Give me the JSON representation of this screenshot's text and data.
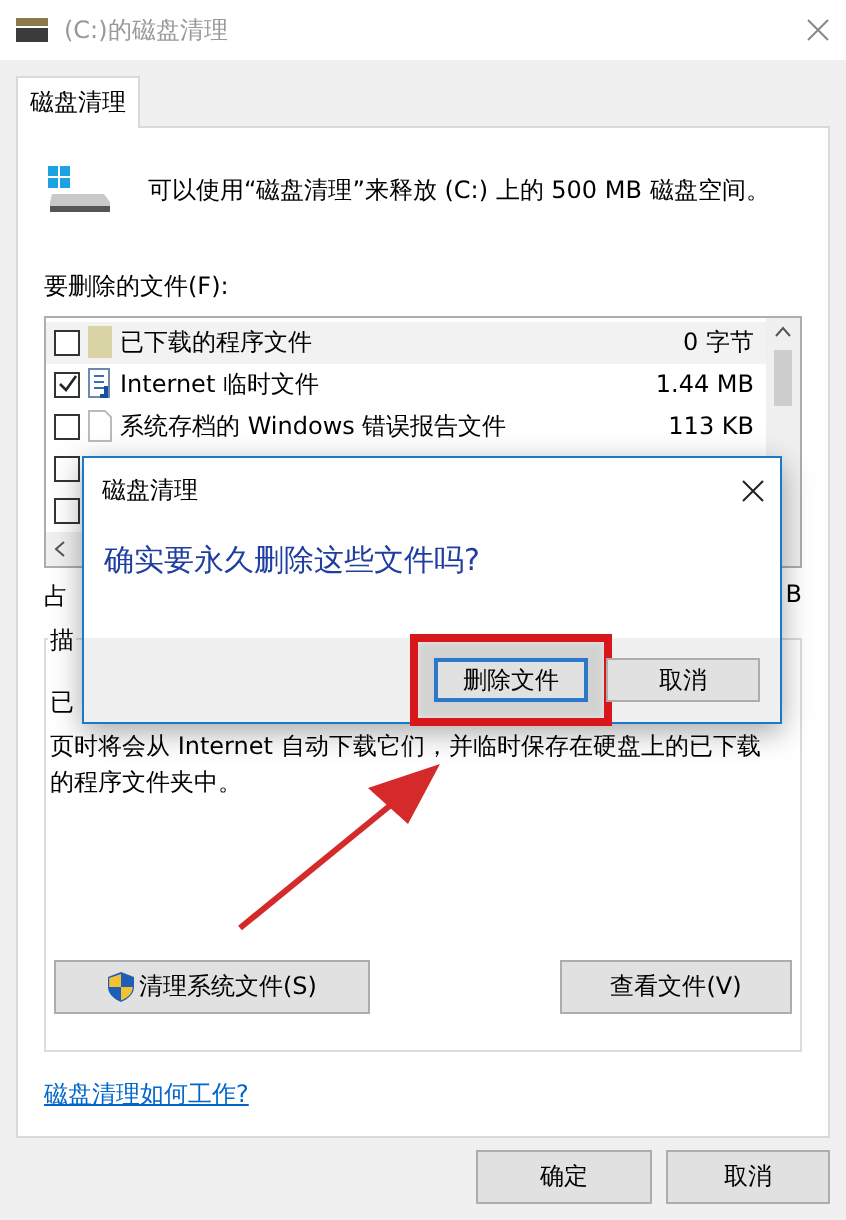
{
  "window": {
    "title": "(C:)的磁盘清理"
  },
  "tabs": [
    {
      "label": "磁盘清理",
      "selected": true
    }
  ],
  "header": {
    "message": "可以使用“磁盘清理”来释放  (C:) 上的 500 MB 磁盘空间。"
  },
  "files": {
    "label": "要删除的文件(F):",
    "rows": [
      {
        "kind": "folder",
        "name": "已下载的程序文件",
        "size": "0 字节",
        "checked": false,
        "selected": true
      },
      {
        "kind": "web",
        "name": "Internet 临时文件",
        "size": "1.44 MB",
        "checked": true,
        "selected": false
      },
      {
        "kind": "doc",
        "name": "系统存档的 Windows 错误报告文件",
        "size": "113 KB",
        "checked": false,
        "selected": false
      },
      {
        "checked": false,
        "selected": false
      },
      {
        "checked": false,
        "selected": false
      }
    ]
  },
  "total": {
    "label": "占",
    "value": "B"
  },
  "description": {
    "label": "描",
    "lines": [
      "已",
      "页时将会从 Internet 自动下载它们，并临时保存在硬盘上的已下载",
      "的程序文件夹中。"
    ]
  },
  "actions": [
    {
      "kind": "shield",
      "label": "清理系统文件(S)"
    },
    {
      "kind": "plain",
      "label": "查看文件(V)"
    }
  ],
  "link": "磁盘清理如何工作?",
  "footer_buttons": [
    {
      "label": "确定"
    },
    {
      "label": "取消"
    }
  ],
  "dialog": {
    "title": "磁盘清理",
    "message": "确实要永久删除这些文件吗?",
    "buttons": [
      {
        "label": "删除文件",
        "default": true,
        "highlighted": true
      },
      {
        "label": "取消",
        "default": false,
        "highlighted": false
      }
    ]
  }
}
